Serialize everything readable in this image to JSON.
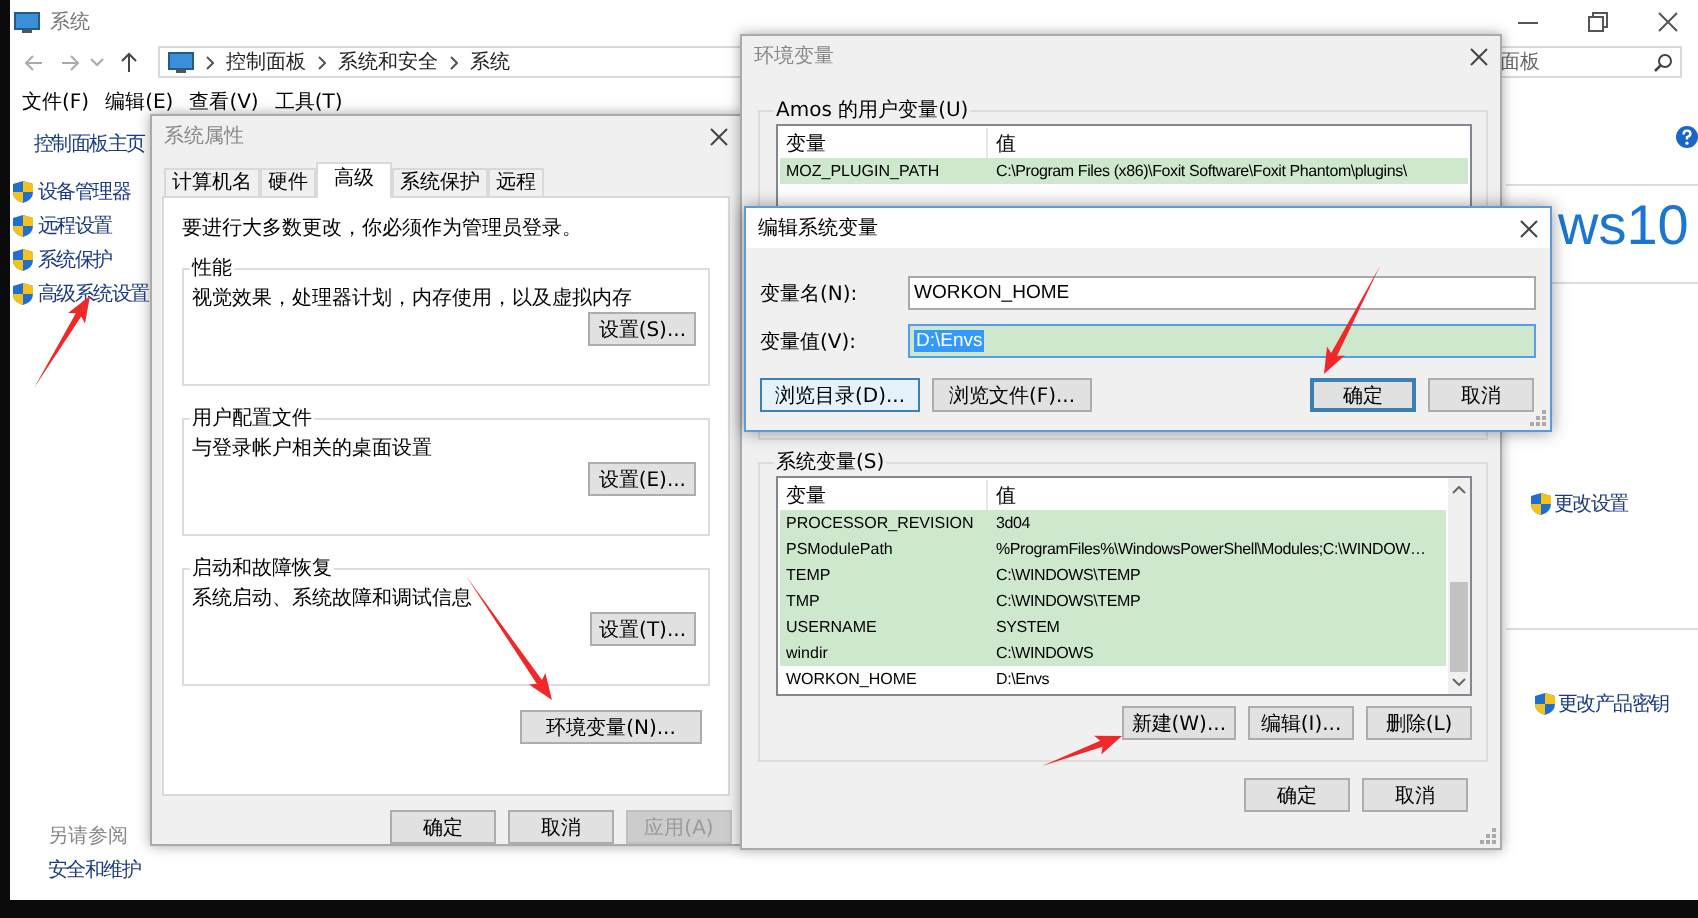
{
  "explorer": {
    "title": "系统",
    "breadcrumb": [
      "控制面板",
      "系统和安全",
      "系统"
    ],
    "search_text": "面板",
    "menu": [
      "文件(F)",
      "编辑(E)",
      "查看(V)",
      "工具(T)"
    ],
    "sidebar": {
      "home": "控制面板主页",
      "items": [
        "设备管理器",
        "远程设置",
        "系统保护",
        "高级系统设置"
      ]
    },
    "see_also": {
      "heading": "另请参阅",
      "links": [
        "安全和维护"
      ]
    },
    "content": {
      "edition_fragment": "ws10",
      "links": [
        "更改设置",
        "更改产品密钥"
      ]
    }
  },
  "system_properties": {
    "title": "系统属性",
    "tabs": [
      {
        "label": "计算机名",
        "selected": false
      },
      {
        "label": "硬件",
        "selected": false
      },
      {
        "label": "高级",
        "selected": true
      },
      {
        "label": "系统保护",
        "selected": false
      },
      {
        "label": "远程",
        "selected": false
      }
    ],
    "notice": "要进行大多数更改，你必须作为管理员登录。",
    "groups": [
      {
        "title": "性能",
        "description": "视觉效果，处理器计划，内存使用，以及虚拟内存",
        "button": "设置(S)..."
      },
      {
        "title": "用户配置文件",
        "description": "与登录帐户相关的桌面设置",
        "button": "设置(E)..."
      },
      {
        "title": "启动和故障恢复",
        "description": "系统启动、系统故障和调试信息",
        "button": "设置(T)..."
      }
    ],
    "env_button": "环境变量(N)...",
    "buttons": [
      {
        "label": "确定",
        "disabled": false
      },
      {
        "label": "取消",
        "disabled": false
      },
      {
        "label": "应用(A)",
        "disabled": true
      }
    ]
  },
  "environment_variables": {
    "title": "环境变量",
    "user_section": {
      "title": "Amos 的用户变量(U)",
      "columns": [
        "变量",
        "值"
      ],
      "rows": [
        {
          "name": "MOZ_PLUGIN_PATH",
          "value": "C:\\Program Files (x86)\\Foxit Software\\Foxit Phantom\\plugins\\",
          "highlighted": true
        }
      ]
    },
    "system_section": {
      "title": "系统变量(S)",
      "columns": [
        "变量",
        "值"
      ],
      "rows": [
        {
          "name": "PROCESSOR_REVISION",
          "value": "3d04",
          "highlighted": true
        },
        {
          "name": "PSModulePath",
          "value": "%ProgramFiles%\\WindowsPowerShell\\Modules;C:\\WINDOW…",
          "highlighted": true
        },
        {
          "name": "TEMP",
          "value": "C:\\WINDOWS\\TEMP",
          "highlighted": true
        },
        {
          "name": "TMP",
          "value": "C:\\WINDOWS\\TEMP",
          "highlighted": true
        },
        {
          "name": "USERNAME",
          "value": "SYSTEM",
          "highlighted": true
        },
        {
          "name": "windir",
          "value": "C:\\WINDOWS",
          "highlighted": true
        },
        {
          "name": "WORKON_HOME",
          "value": "D:\\Envs",
          "highlighted": false
        }
      ],
      "buttons": [
        "新建(W)...",
        "编辑(I)...",
        "删除(L)"
      ]
    },
    "buttons": [
      "确定",
      "取消"
    ]
  },
  "edit_dialog": {
    "title": "编辑系统变量",
    "fields": [
      {
        "label": "变量名(N):",
        "value": "WORKON_HOME",
        "selected": false
      },
      {
        "label": "变量值(V):",
        "value": "D:\\Envs",
        "selected": true
      }
    ],
    "buttons": [
      {
        "label": "浏览目录(D)...",
        "kind": "focused"
      },
      {
        "label": "浏览文件(F)...",
        "kind": "normal"
      },
      {
        "label": "确定",
        "kind": "default"
      },
      {
        "label": "取消",
        "kind": "normal"
      }
    ]
  }
}
